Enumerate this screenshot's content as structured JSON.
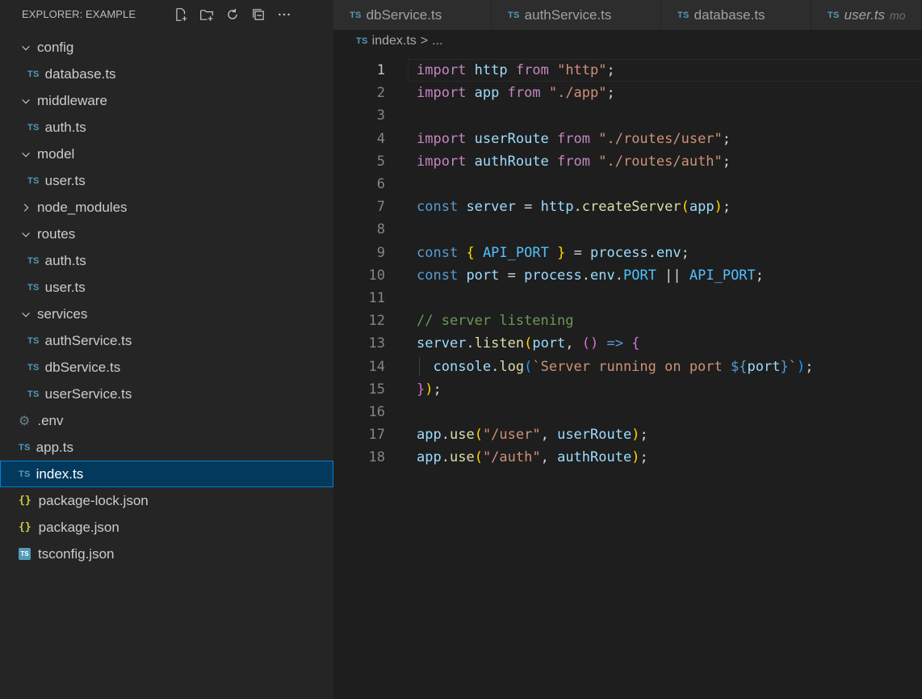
{
  "sidebar": {
    "title": "EXPLORER: EXAMPLE",
    "tree": [
      {
        "label": "config",
        "kind": "folder-open",
        "level": 0
      },
      {
        "label": "database.ts",
        "kind": "ts",
        "level": 1
      },
      {
        "label": "middleware",
        "kind": "folder-open",
        "level": 0
      },
      {
        "label": "auth.ts",
        "kind": "ts",
        "level": 1
      },
      {
        "label": "model",
        "kind": "folder-open",
        "level": 0
      },
      {
        "label": "user.ts",
        "kind": "ts",
        "level": 1
      },
      {
        "label": "node_modules",
        "kind": "folder-closed",
        "level": 0
      },
      {
        "label": "routes",
        "kind": "folder-open",
        "level": 0
      },
      {
        "label": "auth.ts",
        "kind": "ts",
        "level": 1
      },
      {
        "label": "user.ts",
        "kind": "ts",
        "level": 1
      },
      {
        "label": "services",
        "kind": "folder-open",
        "level": 0
      },
      {
        "label": "authService.ts",
        "kind": "ts",
        "level": 1
      },
      {
        "label": "dbService.ts",
        "kind": "ts",
        "level": 1
      },
      {
        "label": "userService.ts",
        "kind": "ts",
        "level": 1
      },
      {
        "label": ".env",
        "kind": "gear",
        "level": 0
      },
      {
        "label": "app.ts",
        "kind": "ts",
        "level": 0
      },
      {
        "label": "index.ts",
        "kind": "ts",
        "level": 0,
        "selected": true
      },
      {
        "label": "package-lock.json",
        "kind": "json",
        "level": 0
      },
      {
        "label": "package.json",
        "kind": "json",
        "level": 0
      },
      {
        "label": "tsconfig.json",
        "kind": "tsconfig",
        "level": 0
      }
    ]
  },
  "icons": {
    "ts_badge": "TS",
    "json_badge": "{}",
    "tsconfig_badge": "TS"
  },
  "tabs": [
    {
      "label": "dbService.ts",
      "italic": false
    },
    {
      "label": "authService.ts",
      "italic": false
    },
    {
      "label": "database.ts",
      "italic": false
    },
    {
      "label": "user.ts",
      "italic": true,
      "description": "mo"
    }
  ],
  "breadcrumb": {
    "file": "index.ts",
    "separator": ">",
    "rest": "..."
  },
  "editor": {
    "active_line": 1,
    "lines": [
      {
        "n": "1",
        "tokens": [
          [
            "kw",
            "import"
          ],
          [
            "pl",
            " "
          ],
          [
            "id",
            "http"
          ],
          [
            "pl",
            " "
          ],
          [
            "kw",
            "from"
          ],
          [
            "pl",
            " "
          ],
          [
            "str",
            "\"http\""
          ],
          [
            "pl",
            ";"
          ]
        ]
      },
      {
        "n": "2",
        "tokens": [
          [
            "kw",
            "import"
          ],
          [
            "pl",
            " "
          ],
          [
            "id",
            "app"
          ],
          [
            "pl",
            " "
          ],
          [
            "kw",
            "from"
          ],
          [
            "pl",
            " "
          ],
          [
            "str",
            "\"./app\""
          ],
          [
            "pl",
            ";"
          ]
        ]
      },
      {
        "n": "3",
        "tokens": []
      },
      {
        "n": "4",
        "tokens": [
          [
            "kw",
            "import"
          ],
          [
            "pl",
            " "
          ],
          [
            "id",
            "userRoute"
          ],
          [
            "pl",
            " "
          ],
          [
            "kw",
            "from"
          ],
          [
            "pl",
            " "
          ],
          [
            "str",
            "\"./routes/user\""
          ],
          [
            "pl",
            ";"
          ]
        ]
      },
      {
        "n": "5",
        "tokens": [
          [
            "kw",
            "import"
          ],
          [
            "pl",
            " "
          ],
          [
            "id",
            "authRoute"
          ],
          [
            "pl",
            " "
          ],
          [
            "kw",
            "from"
          ],
          [
            "pl",
            " "
          ],
          [
            "str",
            "\"./routes/auth\""
          ],
          [
            "pl",
            ";"
          ]
        ]
      },
      {
        "n": "6",
        "tokens": []
      },
      {
        "n": "7",
        "tokens": [
          [
            "kb",
            "const"
          ],
          [
            "pl",
            " "
          ],
          [
            "id",
            "server"
          ],
          [
            "pl",
            " = "
          ],
          [
            "id",
            "http"
          ],
          [
            "pl",
            "."
          ],
          [
            "fn",
            "createServer"
          ],
          [
            "br1",
            "("
          ],
          [
            "id",
            "app"
          ],
          [
            "br1",
            ")"
          ],
          [
            "pl",
            ";"
          ]
        ]
      },
      {
        "n": "8",
        "tokens": []
      },
      {
        "n": "9",
        "tokens": [
          [
            "kb",
            "const"
          ],
          [
            "pl",
            " "
          ],
          [
            "br1",
            "{"
          ],
          [
            "pl",
            " "
          ],
          [
            "cst",
            "API_PORT"
          ],
          [
            "pl",
            " "
          ],
          [
            "br1",
            "}"
          ],
          [
            "pl",
            " = "
          ],
          [
            "id",
            "process"
          ],
          [
            "pl",
            "."
          ],
          [
            "id",
            "env"
          ],
          [
            "pl",
            ";"
          ]
        ]
      },
      {
        "n": "10",
        "tokens": [
          [
            "kb",
            "const"
          ],
          [
            "pl",
            " "
          ],
          [
            "id",
            "port"
          ],
          [
            "pl",
            " = "
          ],
          [
            "id",
            "process"
          ],
          [
            "pl",
            "."
          ],
          [
            "id",
            "env"
          ],
          [
            "pl",
            "."
          ],
          [
            "cst",
            "PORT"
          ],
          [
            "pl",
            " || "
          ],
          [
            "cst",
            "API_PORT"
          ],
          [
            "pl",
            ";"
          ]
        ]
      },
      {
        "n": "11",
        "tokens": []
      },
      {
        "n": "12",
        "tokens": [
          [
            "cm",
            "// server listening"
          ]
        ]
      },
      {
        "n": "13",
        "tokens": [
          [
            "id",
            "server"
          ],
          [
            "pl",
            "."
          ],
          [
            "fn",
            "listen"
          ],
          [
            "br1",
            "("
          ],
          [
            "id",
            "port"
          ],
          [
            "pl",
            ", "
          ],
          [
            "br2",
            "()"
          ],
          [
            "pl",
            " "
          ],
          [
            "kb",
            "=>"
          ],
          [
            "pl",
            " "
          ],
          [
            "br2",
            "{"
          ]
        ]
      },
      {
        "n": "14",
        "tokens": [
          [
            "pl",
            "  "
          ],
          [
            "id",
            "console"
          ],
          [
            "pl",
            "."
          ],
          [
            "fn",
            "log"
          ],
          [
            "br3",
            "("
          ],
          [
            "str",
            "`Server running on port "
          ],
          [
            "kb",
            "${"
          ],
          [
            "id",
            "port"
          ],
          [
            "kb",
            "}"
          ],
          [
            "str",
            "`"
          ],
          [
            "br3",
            ")"
          ],
          [
            "pl",
            ";"
          ]
        ],
        "indent": true
      },
      {
        "n": "15",
        "tokens": [
          [
            "br2",
            "}"
          ],
          [
            "br1",
            ")"
          ],
          [
            "pl",
            ";"
          ]
        ]
      },
      {
        "n": "16",
        "tokens": []
      },
      {
        "n": "17",
        "tokens": [
          [
            "id",
            "app"
          ],
          [
            "pl",
            "."
          ],
          [
            "fn",
            "use"
          ],
          [
            "br1",
            "("
          ],
          [
            "str",
            "\"/user\""
          ],
          [
            "pl",
            ", "
          ],
          [
            "id",
            "userRoute"
          ],
          [
            "br1",
            ")"
          ],
          [
            "pl",
            ";"
          ]
        ]
      },
      {
        "n": "18",
        "tokens": [
          [
            "id",
            "app"
          ],
          [
            "pl",
            "."
          ],
          [
            "fn",
            "use"
          ],
          [
            "br1",
            "("
          ],
          [
            "str",
            "\"/auth\""
          ],
          [
            "pl",
            ", "
          ],
          [
            "id",
            "authRoute"
          ],
          [
            "br1",
            ")"
          ],
          [
            "pl",
            ";"
          ]
        ]
      }
    ]
  }
}
